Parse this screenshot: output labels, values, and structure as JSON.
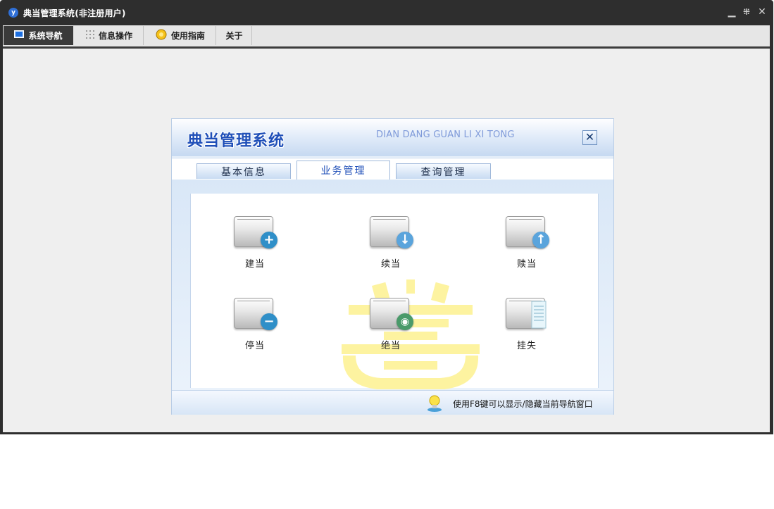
{
  "window": {
    "title": "典当管理系统(非注册用户)",
    "app_icon_glyph": "y",
    "controls": [
      "minimize-icon",
      "restore-icon",
      "close-icon"
    ]
  },
  "menubar": {
    "tabs": [
      {
        "label": "系统导航",
        "icon": "monitor-icon",
        "active": true
      },
      {
        "label": "信息操作",
        "icon": "grid-icon",
        "active": false
      },
      {
        "label": "使用指南",
        "icon": "help-icon",
        "active": false
      },
      {
        "label": "关于",
        "icon": "",
        "active": false
      }
    ]
  },
  "panel": {
    "title": "典当管理系统",
    "subtitle": "DIAN DANG GUAN LI XI TONG",
    "close_glyph": "✕",
    "tabs": [
      {
        "label": "基本信息",
        "active": false
      },
      {
        "label": "业务管理",
        "active": true
      },
      {
        "label": "查询管理",
        "active": false
      }
    ],
    "functions": [
      {
        "label": "建当",
        "badge": "+",
        "badge_color": "#2f8fc8"
      },
      {
        "label": "续当",
        "badge": "↓",
        "badge_color": "#5aa4dc"
      },
      {
        "label": "赎当",
        "badge": "↑",
        "badge_color": "#5aa4dc"
      },
      {
        "label": "停当",
        "badge": "−",
        "badge_color": "#2f8fc8"
      },
      {
        "label": "绝当",
        "badge": "◉",
        "badge_color": "#4a9a6a"
      },
      {
        "label": "挂失",
        "badge": "",
        "badge_color": ""
      }
    ],
    "hint": "使用F8键可以显示/隐藏当前导航窗口"
  },
  "colors": {
    "titlebar": "#2e2e2e",
    "panel_accent": "#1f4fb8",
    "watermark": "#fdf3a0"
  }
}
